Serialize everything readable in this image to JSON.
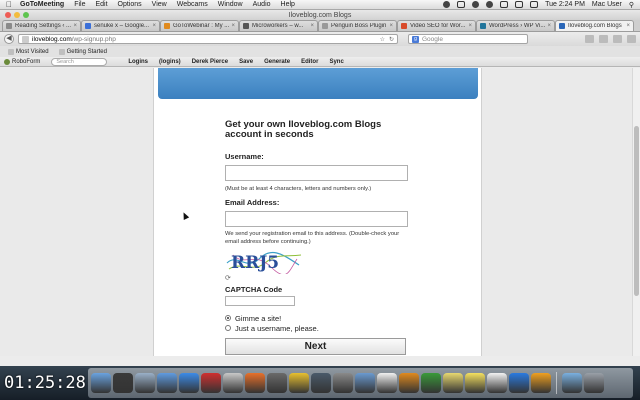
{
  "menubar": {
    "app_name": "GoToMeeting",
    "items": [
      "File",
      "Edit",
      "Options",
      "View",
      "Webcams",
      "Window",
      "Audio",
      "Help"
    ],
    "clock": "Tue 2:24 PM",
    "user": "Mac User"
  },
  "window": {
    "title": "Iloveblog.com Blogs"
  },
  "tabs": [
    {
      "label": "Reading Settings ‹ ...",
      "color": "#8a8a8a",
      "active": false
    },
    {
      "label": "senuke x – Google...",
      "color": "#3a6fd8",
      "active": false
    },
    {
      "label": "GoToWebinar : My ...",
      "color": "#e08a1e",
      "active": false
    },
    {
      "label": "Microworkers – w...",
      "color": "#555555",
      "active": false
    },
    {
      "label": "Penguin Boss Plugin",
      "color": "#999999",
      "active": false
    },
    {
      "label": "Video SEO for Wor...",
      "color": "#d84a2a",
      "active": false
    },
    {
      "label": "WordPress › WP Vi...",
      "color": "#21759b",
      "active": false
    },
    {
      "label": "Iloveblog.com Blogs",
      "color": "#2a66b8",
      "active": true
    }
  ],
  "nav": {
    "url_host": "iloveblog.com",
    "url_path": "/wp-signup.php",
    "search_placeholder": "Google"
  },
  "bookmarks": [
    {
      "label": "Most Visited"
    },
    {
      "label": "Getting Started"
    }
  ],
  "roboform": {
    "brand": "RoboForm",
    "search_placeholder": "Search",
    "items": [
      "Logins",
      "(logins)",
      "Derek Pierce",
      "Save",
      "Generate",
      "Editor",
      "Sync"
    ]
  },
  "form": {
    "title": "Get your own Iloveblog.com Blogs account in seconds",
    "username_label": "Username:",
    "username_value": "",
    "username_hint": "(Must be at least 4 characters, letters and numbers only.)",
    "email_label": "Email Address:",
    "email_value": "",
    "email_hint": "We send your registration email to this address. (Double-check your email address before continuing.)",
    "captcha_text": "RRJ5",
    "captcha_label": "CAPTCHA Code",
    "captcha_value": "",
    "radio_options": [
      {
        "label": "Gimme a site!",
        "selected": true
      },
      {
        "label": "Just a username, please.",
        "selected": false
      }
    ],
    "submit_label": "Next"
  },
  "recording": {
    "timer": "01:25:28"
  },
  "colors": {
    "banner": "#4a8fcc",
    "desktop": "#1d2a38"
  },
  "dock": {
    "icons": [
      "finder-icon",
      "dashboard-icon",
      "mail-icon",
      "itunes-icon",
      "app-store-icon",
      "photo-booth-icon",
      "launchpad-icon",
      "firefox-icon",
      "rocket-icon",
      "chrome-icon",
      "time-machine-icon",
      "system-preferences-icon",
      "preview-icon",
      "textedit-icon",
      "gotomeeting-icon",
      "camtasia-icon",
      "notes-icon",
      "stickies-icon",
      "calendar-icon",
      "teamviewer-icon",
      "flower-icon",
      "folder-icon",
      "trash-icon"
    ]
  }
}
